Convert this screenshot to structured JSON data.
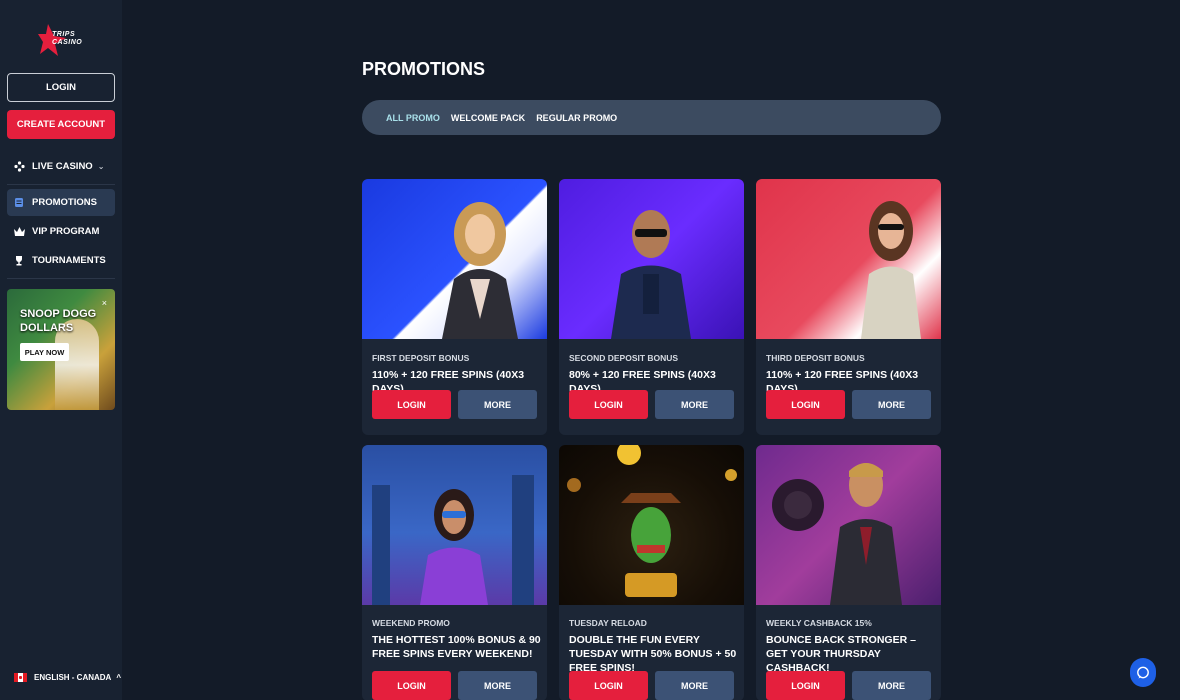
{
  "brand": {
    "logo_text_1": "TRIPS",
    "logo_text_2": "CASINO"
  },
  "sidebar": {
    "login_label": "LOGIN",
    "create_account_label": "CREATE ACCOUNT",
    "live_casino_label": "LIVE CASINO",
    "items": [
      {
        "label": "PROMOTIONS",
        "icon": "promotions-icon",
        "active": true
      },
      {
        "label": "VIP PROGRAM",
        "icon": "crown-icon",
        "active": false
      },
      {
        "label": "TOURNAMENTS",
        "icon": "trophy-icon",
        "active": false
      }
    ],
    "banner": {
      "title": "SNOOP DOGG DOLLARS",
      "cta": "PLAY NOW",
      "close": "×"
    },
    "language": "ENGLISH - CANADA"
  },
  "main": {
    "title": "PROMOTIONS",
    "filters": [
      {
        "label": "ALL PROMO",
        "active": true
      },
      {
        "label": "WELCOME PACK",
        "active": false
      },
      {
        "label": "REGULAR PROMO",
        "active": false
      }
    ],
    "cards": [
      {
        "category": "FIRST DEPOSIT BONUS",
        "headline": "110% + 120 FREE SPINS (40X3 DAYS)",
        "login": "LOGIN",
        "more": "MORE"
      },
      {
        "category": "SECOND DEPOSIT BONUS",
        "headline": "80% + 120 FREE SPINS (40X3 DAYS)",
        "login": "LOGIN",
        "more": "MORE"
      },
      {
        "category": "THIRD DEPOSIT BONUS",
        "headline": "110% + 120 FREE SPINS (40X3 DAYS)",
        "login": "LOGIN",
        "more": "MORE"
      },
      {
        "category": "WEEKEND PROMO",
        "headline": "THE HOTTEST 100% BONUS & 90 FREE SPINS EVERY WEEKEND!",
        "login": "LOGIN",
        "more": "MORE"
      },
      {
        "category": "TUESDAY RELOAD",
        "headline": "DOUBLE THE FUN EVERY TUESDAY WITH 50% BONUS + 50 FREE SPINS!",
        "login": "LOGIN",
        "more": "MORE"
      },
      {
        "category": "WEEKLY CASHBACK 15%",
        "headline": "BOUNCE BACK STRONGER – GET YOUR THURSDAY CASHBACK!",
        "login": "LOGIN",
        "more": "MORE"
      }
    ]
  },
  "colors": {
    "background": "#131b28",
    "sidebar": "#182231",
    "accent_red": "#e51f3d",
    "more_button": "#3c5275",
    "active_filter": "#a9e0ea",
    "chat": "#1e60e6"
  }
}
